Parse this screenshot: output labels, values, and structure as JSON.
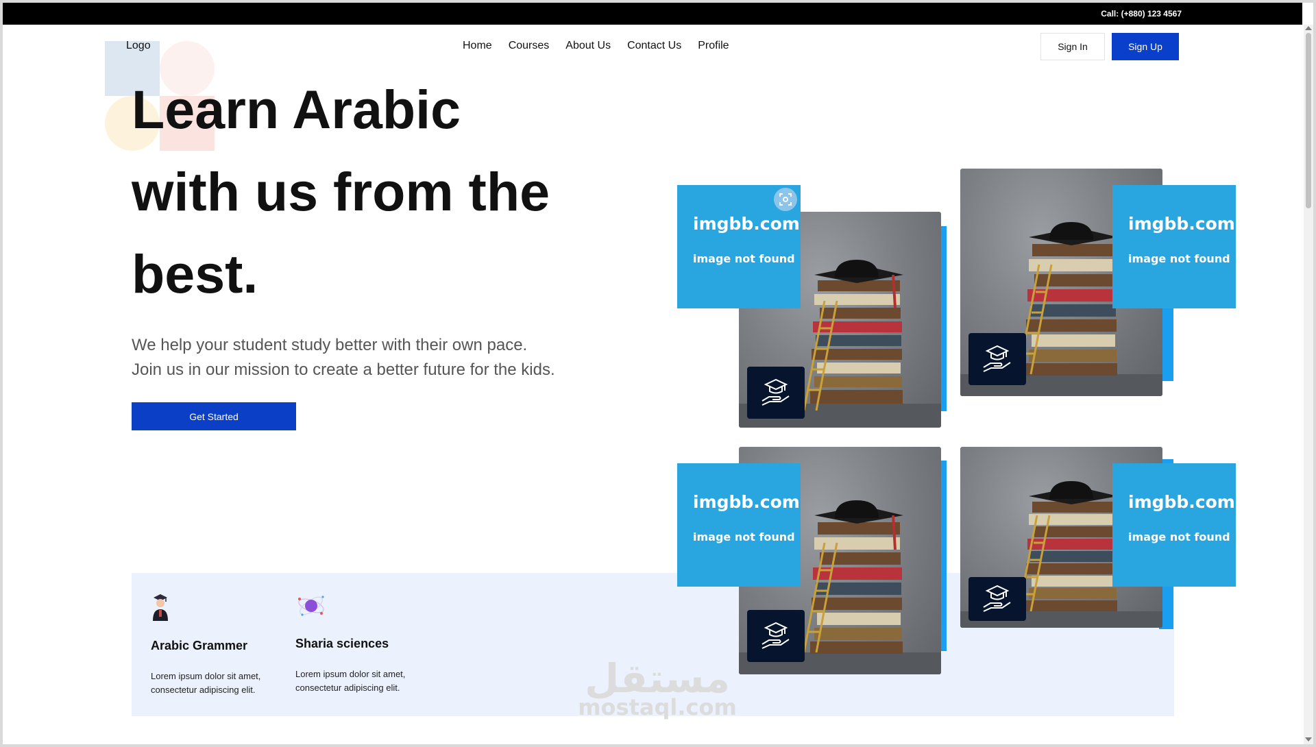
{
  "topbar": {
    "call_text": "Call: (+880) 123 4567"
  },
  "header": {
    "logo": "Logo",
    "nav": [
      "Home",
      "Courses",
      "About Us",
      "Contact Us",
      "Profile"
    ],
    "sign_in": "Sign In",
    "sign_up": "Sign Up"
  },
  "hero": {
    "title_line1": "Learn Arabic",
    "title_line2": "with us from the",
    "title_line3": "best.",
    "desc_line1": "We help your student study better with their own pace.",
    "desc_line2": "Join us in our mission to create a better future for the kids.",
    "cta": "Get Started"
  },
  "gallery": {
    "placeholder_title": "imgbb.com",
    "placeholder_sub": "image not found",
    "accent_color": "#1a9ff0",
    "placeholder_color": "#29a6e0",
    "badge_color": "#06142e"
  },
  "features": [
    {
      "title": "Arabic Grammer",
      "desc_line1": "Lorem ipsum dolor sit amet,",
      "desc_line2": "consectetur adipiscing elit.",
      "icon": "graduate-student-icon"
    },
    {
      "title": "Sharia sciences",
      "desc_line1": "Lorem ipsum dolor sit amet,",
      "desc_line2": "consectetur adipiscing elit.",
      "icon": "atom-orbit-icon"
    }
  ],
  "watermark": {
    "arabic": "مستقل",
    "latin": "mostaql.com"
  },
  "colors": {
    "primary": "#0a3fcc",
    "topbar": "#000000",
    "features_bg": "#ebf1fd"
  }
}
